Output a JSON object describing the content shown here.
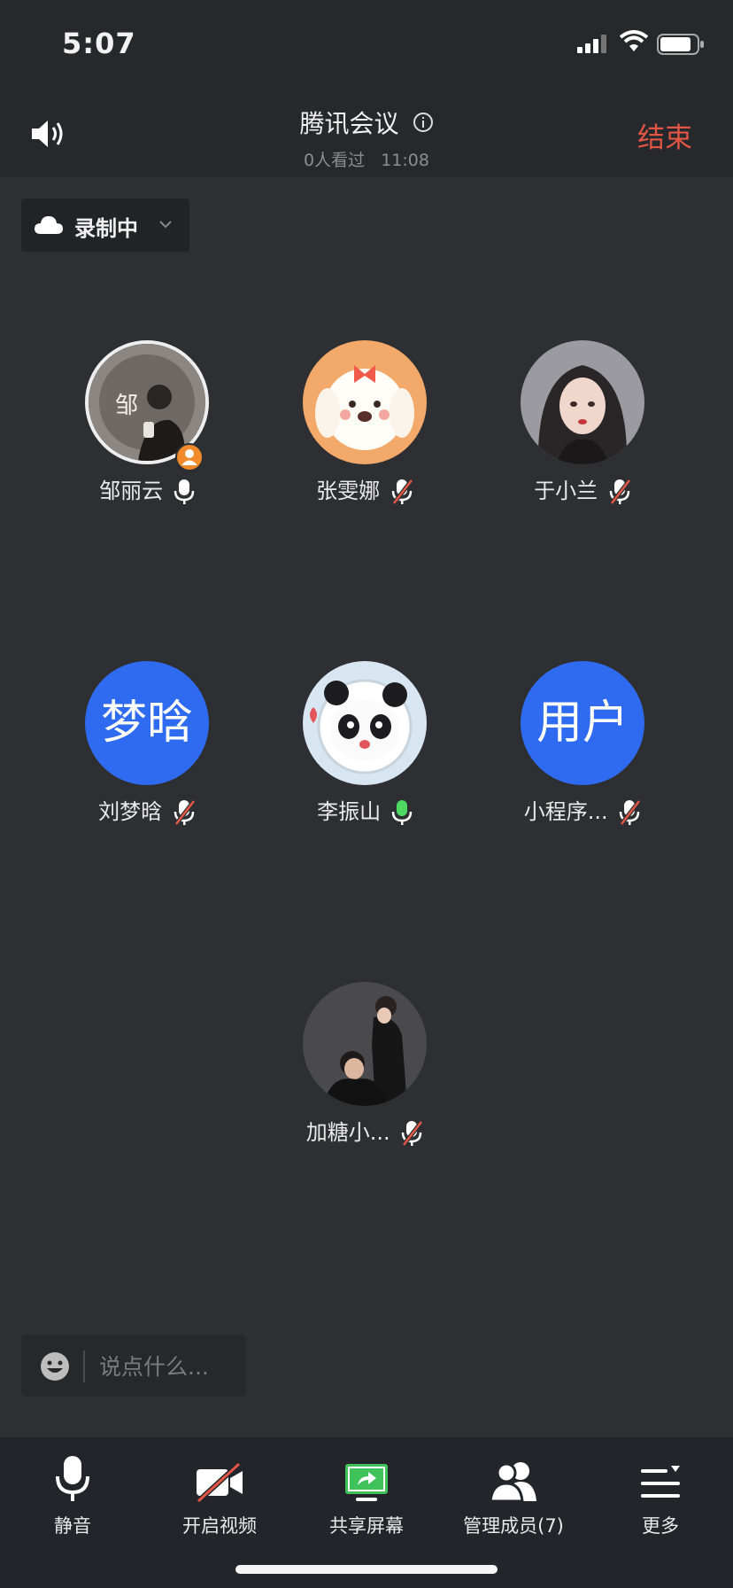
{
  "status_bar": {
    "time": "5:07"
  },
  "header": {
    "title": "腾讯会议",
    "viewers": "0人看过",
    "duration": "11:08",
    "end_label": "结束",
    "end_color": "#e25646"
  },
  "recording": {
    "label": "录制中"
  },
  "participants": [
    {
      "name": "邹丽云",
      "mic": "on",
      "avatar": "photo",
      "host": true
    },
    {
      "name": "张雯娜",
      "mic": "muted",
      "avatar": "cartoon-dog"
    },
    {
      "name": "于小兰",
      "mic": "muted",
      "avatar": "illustration-girl"
    },
    {
      "name": "刘梦晗",
      "mic": "muted",
      "avatar": "text",
      "avatar_text": "梦晗"
    },
    {
      "name": "李振山",
      "mic": "speaking",
      "avatar": "cartoon-panda"
    },
    {
      "name": "小程序...",
      "mic": "muted",
      "avatar": "text",
      "avatar_text": "用户"
    },
    {
      "name": "加糖小...",
      "mic": "muted",
      "avatar": "photo-couple"
    }
  ],
  "chat": {
    "placeholder": "说点什么..."
  },
  "toolbar": {
    "mute": "静音",
    "video": "开启视频",
    "share": "共享屏幕",
    "members": "管理成员(7)",
    "more": "更多"
  },
  "colors": {
    "accent_blue": "#2f6bf0",
    "speaking_green": "#4cd964",
    "share_green": "#3fc25a",
    "muted_red": "#e25646"
  }
}
